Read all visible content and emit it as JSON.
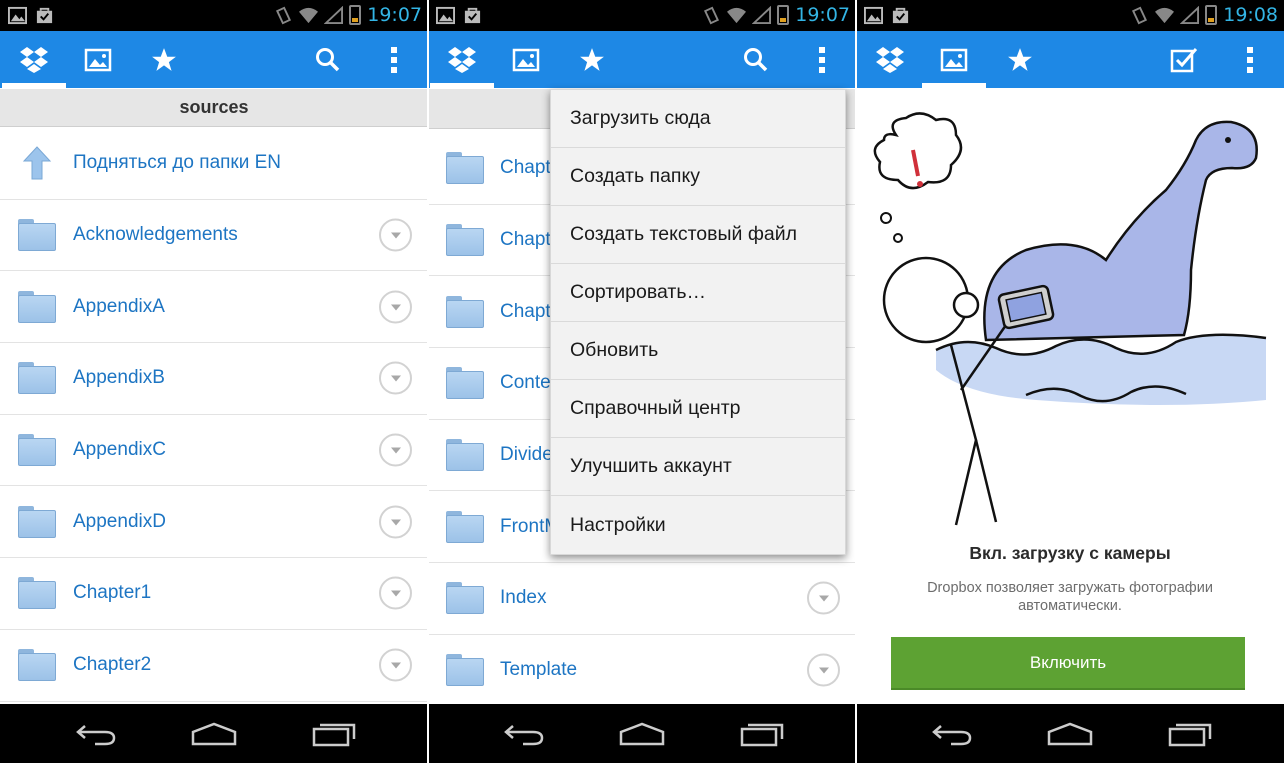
{
  "screens": {
    "files": {
      "status_time": "19:07",
      "path_header": "sources",
      "up_label": "Подняться до папки EN",
      "folders": [
        "Acknowledgements",
        "AppendixA",
        "AppendixB",
        "AppendixC",
        "AppendixD",
        "Chapter1",
        "Chapter2"
      ]
    },
    "menu_screen": {
      "status_time": "19:07",
      "folders_partial": [
        "Chapt",
        "Chapt",
        "Chapt",
        "Conte",
        "Divide",
        "FrontM"
      ],
      "folders": [
        "Index",
        "Template"
      ],
      "menu_items": [
        "Загрузить сюда",
        "Создать папку",
        "Создать текстовый файл",
        "Сортировать…",
        "Обновить",
        "Справочный центр",
        "Улучшить аккаунт",
        "Настройки"
      ]
    },
    "camera_upload": {
      "status_time": "19:08",
      "title": "Вкл. загрузку с камеры",
      "description": "Dropbox позволяет загружать фотографии автоматически.",
      "enable_button": "Включить"
    }
  },
  "icons": {
    "actionbar_tabs": [
      "dropbox-icon",
      "photos-icon",
      "favorites-star-icon"
    ],
    "actionbar_actions_files": [
      "search-icon",
      "overflow-menu-icon"
    ],
    "actionbar_actions_camera": [
      "select-checkbox-icon",
      "overflow-menu-icon"
    ],
    "navbar": [
      "back-icon",
      "home-icon",
      "recent-apps-icon"
    ]
  },
  "colors": {
    "actionbar": "#1e88e5",
    "link_text": "#1d75c3",
    "status_time": "#33b5e5",
    "enable_button": "#5da233"
  }
}
